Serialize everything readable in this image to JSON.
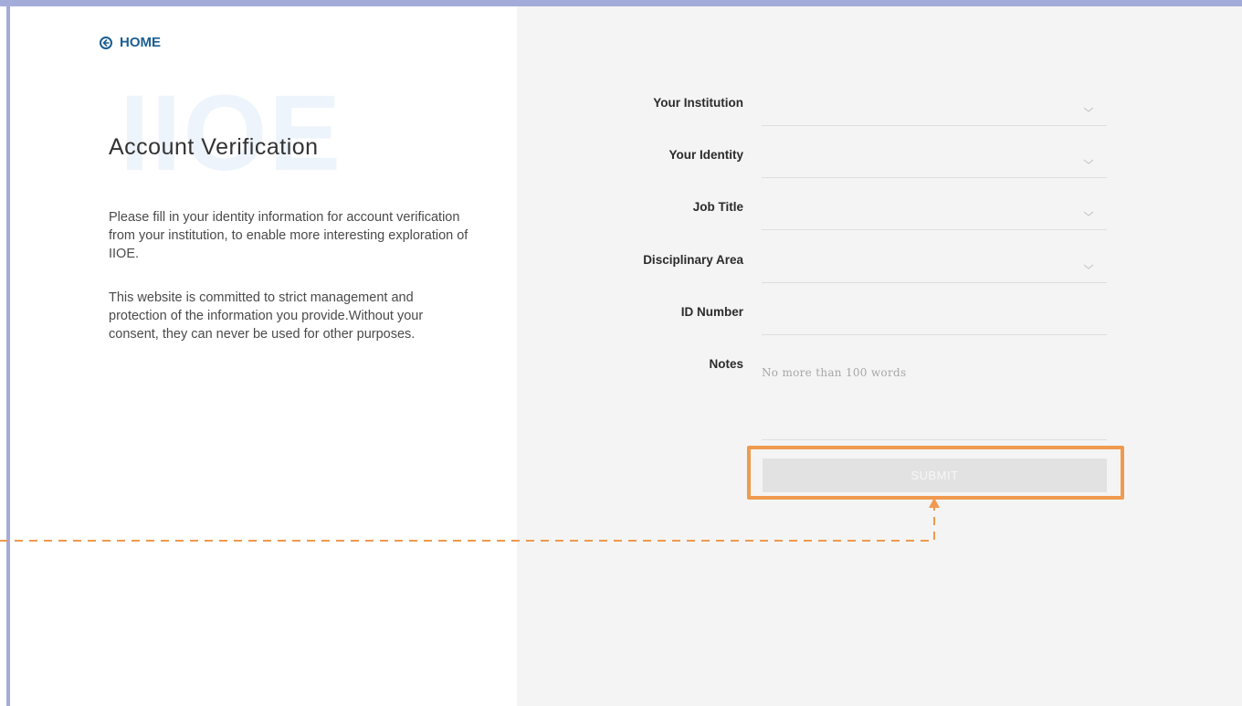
{
  "home": {
    "label": "HOME"
  },
  "watermark": "IIOE",
  "page": {
    "title": "Account Verification",
    "description_1": "Please fill in your identity information for account verification from your institution, to enable more interesting exploration of IIOE.",
    "description_2": "This website is committed to strict management and protection of the information you provide.Without your consent, they can never be used for other purposes."
  },
  "form": {
    "fields": [
      {
        "label": "Your Institution",
        "type": "select",
        "value": ""
      },
      {
        "label": "Your Identity",
        "type": "select",
        "value": ""
      },
      {
        "label": "Job Title",
        "type": "select",
        "value": ""
      },
      {
        "label": "Disciplinary Area",
        "type": "select",
        "value": ""
      },
      {
        "label": "ID Number",
        "type": "text",
        "value": ""
      },
      {
        "label": "Notes",
        "type": "textarea",
        "value": ""
      }
    ],
    "notes_placeholder": "No more than 100 words",
    "submit_label": "SUBMIT"
  },
  "colors": {
    "frame": "#a3acd9",
    "accent_link": "#1c5f93",
    "highlight": "#ef9a4e",
    "right_panel_bg": "#f4f4f4",
    "button_disabled_bg": "#e2e2e2"
  }
}
